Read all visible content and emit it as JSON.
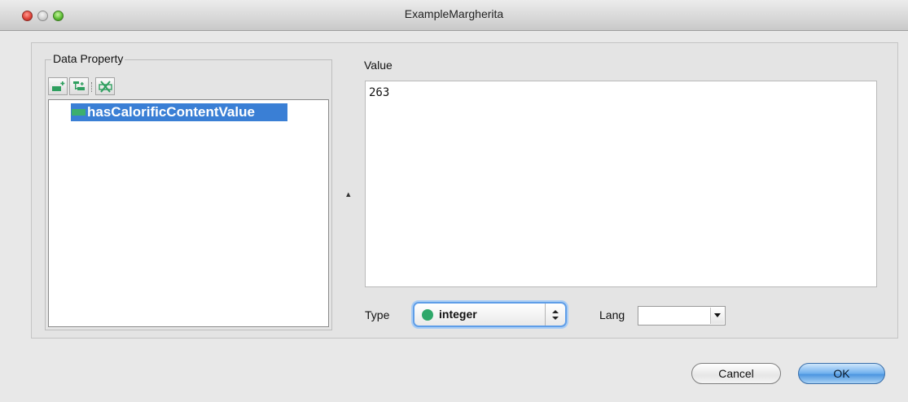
{
  "window": {
    "title": "ExampleMargherita"
  },
  "data_property": {
    "group_label": "Data Property",
    "toolbar": [
      {
        "icon": "add-property-icon"
      },
      {
        "icon": "add-subproperty-icon"
      },
      {
        "icon": "delete-icon"
      }
    ],
    "items": [
      {
        "label": "hasCalorificContentValue",
        "selected": true,
        "icon": "data-property-icon",
        "icon_color": "#3daf6e"
      }
    ]
  },
  "value": {
    "label": "Value",
    "text": "263"
  },
  "type": {
    "label": "Type",
    "selected": "integer",
    "dot_color": "#2fa86a"
  },
  "lang": {
    "label": "Lang",
    "selected": ""
  },
  "buttons": {
    "cancel": "Cancel",
    "ok": "OK"
  },
  "colors": {
    "selection": "#3a7fd5",
    "ok_button": "#4c95e0"
  }
}
